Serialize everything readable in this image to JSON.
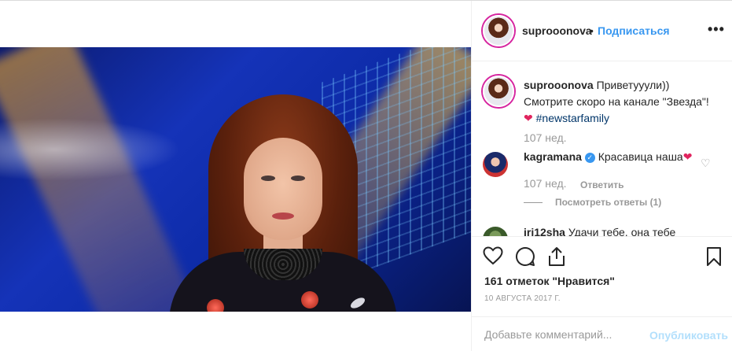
{
  "post": {
    "author": {
      "username": "suprooonova",
      "follow_label": "Подписаться",
      "separator": "•",
      "more_icon": "more-horizontal-icon",
      "more_glyph": "•••"
    },
    "caption": {
      "username": "suprooonova",
      "line1": "Приветууули))",
      "line2": "Смотрите скоро на канале \"Звезда\"!",
      "heart": "❤",
      "hashtag": "#newstarfamily",
      "time": "107 нед."
    },
    "comments": [
      {
        "username": "kagramana",
        "verified": true,
        "text": "Красавица наша",
        "heart": "❤",
        "time": "107 нед.",
        "reply_label": "Ответить",
        "view_replies_label": "Посмотреть ответы (1)",
        "like_icon": "heart-outline-icon"
      },
      {
        "username": "iri12sha",
        "text": "Удачи тебе, она тебе"
      }
    ],
    "actions": {
      "like_icon": "heart-outline-icon",
      "comment_icon": "comment-icon",
      "share_icon": "share-icon",
      "save_icon": "bookmark-icon"
    },
    "likes_text": "161 отметок \"Нравится\"",
    "date": "10 АВГУСТА 2017 Г.",
    "add_comment": {
      "placeholder": "Добавьте комментарий...",
      "publish_label": "Опубликовать"
    }
  },
  "colors": {
    "link_blue": "#3897f0",
    "publish_disabled": "#b2dffc",
    "heart_red": "#e0245e",
    "hashtag": "#003569",
    "muted": "#999999"
  }
}
